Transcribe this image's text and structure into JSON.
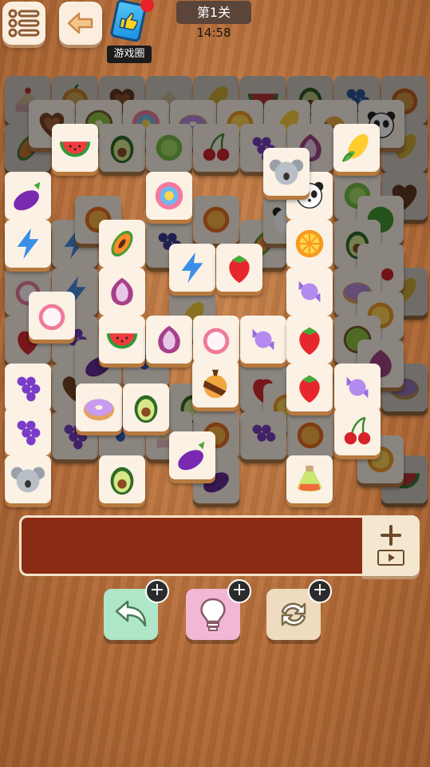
{
  "header": {
    "menu_icon": "list-menu-icon",
    "back_icon": "arrow-left-icon",
    "game_circle": {
      "label": "游戏圈",
      "icon": "thumbs-up-card-icon",
      "badge_color": "#e8222b"
    },
    "level": "第1关",
    "timer": "14:58"
  },
  "board": {
    "tile_types": [
      "watermelon",
      "eggplant",
      "lightning",
      "papaya",
      "onion",
      "radish",
      "avocado",
      "grapes",
      "koala",
      "donut",
      "lollipop",
      "strawberry",
      "candy",
      "orange",
      "panda",
      "corn",
      "cherry",
      "chocolate",
      "potion",
      "heart-cookie",
      "kiwi",
      "lettuce",
      "cake"
    ]
  },
  "tray": {
    "capacity_add_icon": "plus-video-icon"
  },
  "tools": [
    {
      "name": "undo",
      "icon": "undo-arrow-icon",
      "color": "#aee6c7"
    },
    {
      "name": "hint",
      "icon": "lightbulb-icon",
      "color": "#f1b7d4"
    },
    {
      "name": "shuffle",
      "icon": "shuffle-arrows-icon",
      "color": "#eedbc0"
    }
  ]
}
